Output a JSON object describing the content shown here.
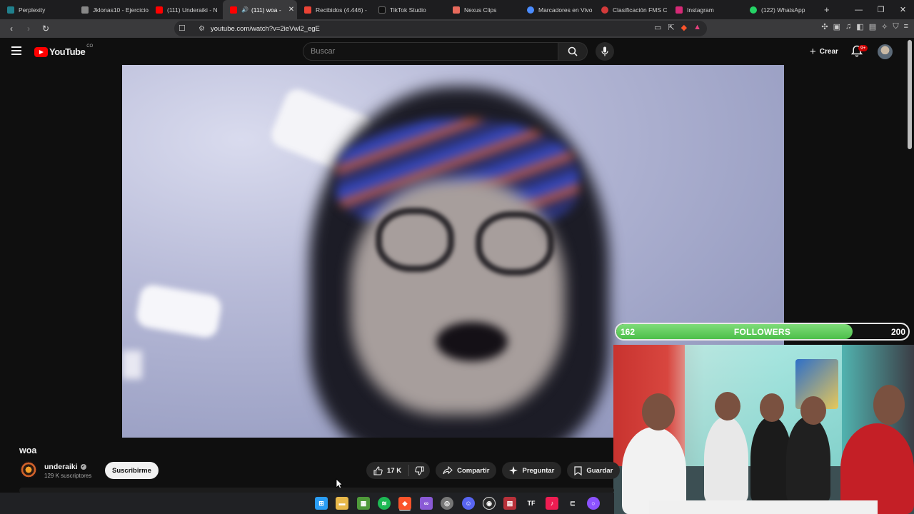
{
  "browser": {
    "tabs": [
      {
        "label": "Perplexity",
        "color": "#20808d"
      },
      {
        "label": "Jklonas10 - Ejercicio",
        "color": "#888888"
      },
      {
        "label": "(111) Underaiki - N",
        "color": "#ff0000"
      },
      {
        "label": "(111) woa -",
        "color": "#ff0000",
        "active": true
      },
      {
        "label": "Recibidos (4.446) -",
        "color": "#ea4335"
      },
      {
        "label": "TikTok Studio",
        "color": "#111111"
      },
      {
        "label": "Nexus Clips",
        "color": "#e86a5c"
      },
      {
        "label": "Marcadores en Vivo",
        "color": "#4a8cff"
      },
      {
        "label": "Clasificación FMS C",
        "color": "#d33a3a"
      },
      {
        "label": "Instagram",
        "color": "#d62976"
      },
      {
        "label": "(122) WhatsApp",
        "color": "#25d366"
      }
    ],
    "new_tab": "+",
    "url": "youtube.com/watch?v=2ieVwl2_egE"
  },
  "youtube": {
    "logo_text": "YouTube",
    "country_code": "CO",
    "search_placeholder": "Buscar",
    "create_label": "Crear",
    "notifications_badge": "9+"
  },
  "overlay": {
    "followers_current": "162",
    "followers_label": "FOLLOWERS",
    "followers_goal": "200",
    "progress_fraction": 0.81
  },
  "video": {
    "title": "woa",
    "channel_name": "underaiki",
    "subscribers": "129 K suscriptores",
    "subscribe_label": "Suscribirme",
    "likes": "17 K",
    "share_label": "Compartir",
    "ask_label": "Preguntar",
    "save_label": "Guardar"
  },
  "taskbar": {
    "icons": [
      {
        "name": "windows-start-icon",
        "color": "#2a9df4"
      },
      {
        "name": "file-explorer-icon",
        "color": "#e8b84a"
      },
      {
        "name": "minecraft-icon",
        "color": "#4f9a3a"
      },
      {
        "name": "spotify-icon",
        "color": "#1db954"
      },
      {
        "name": "brave-icon",
        "color": "#fb542b"
      },
      {
        "name": "visual-studio-icon",
        "color": "#8a5ad6"
      },
      {
        "name": "chrome-icon",
        "color": "#777777"
      },
      {
        "name": "discord-icon",
        "color": "#5865f2"
      },
      {
        "name": "obs-icon",
        "color": "#2b2b2b"
      },
      {
        "name": "app-icon",
        "color": "#b8313a"
      },
      {
        "name": "tf-icon",
        "color": "#202124"
      },
      {
        "name": "tiktok-icon",
        "color": "#ee1d52"
      },
      {
        "name": "capcut-icon",
        "color": "#202124"
      },
      {
        "name": "circle-app-icon",
        "color": "#8c52ff"
      }
    ]
  }
}
